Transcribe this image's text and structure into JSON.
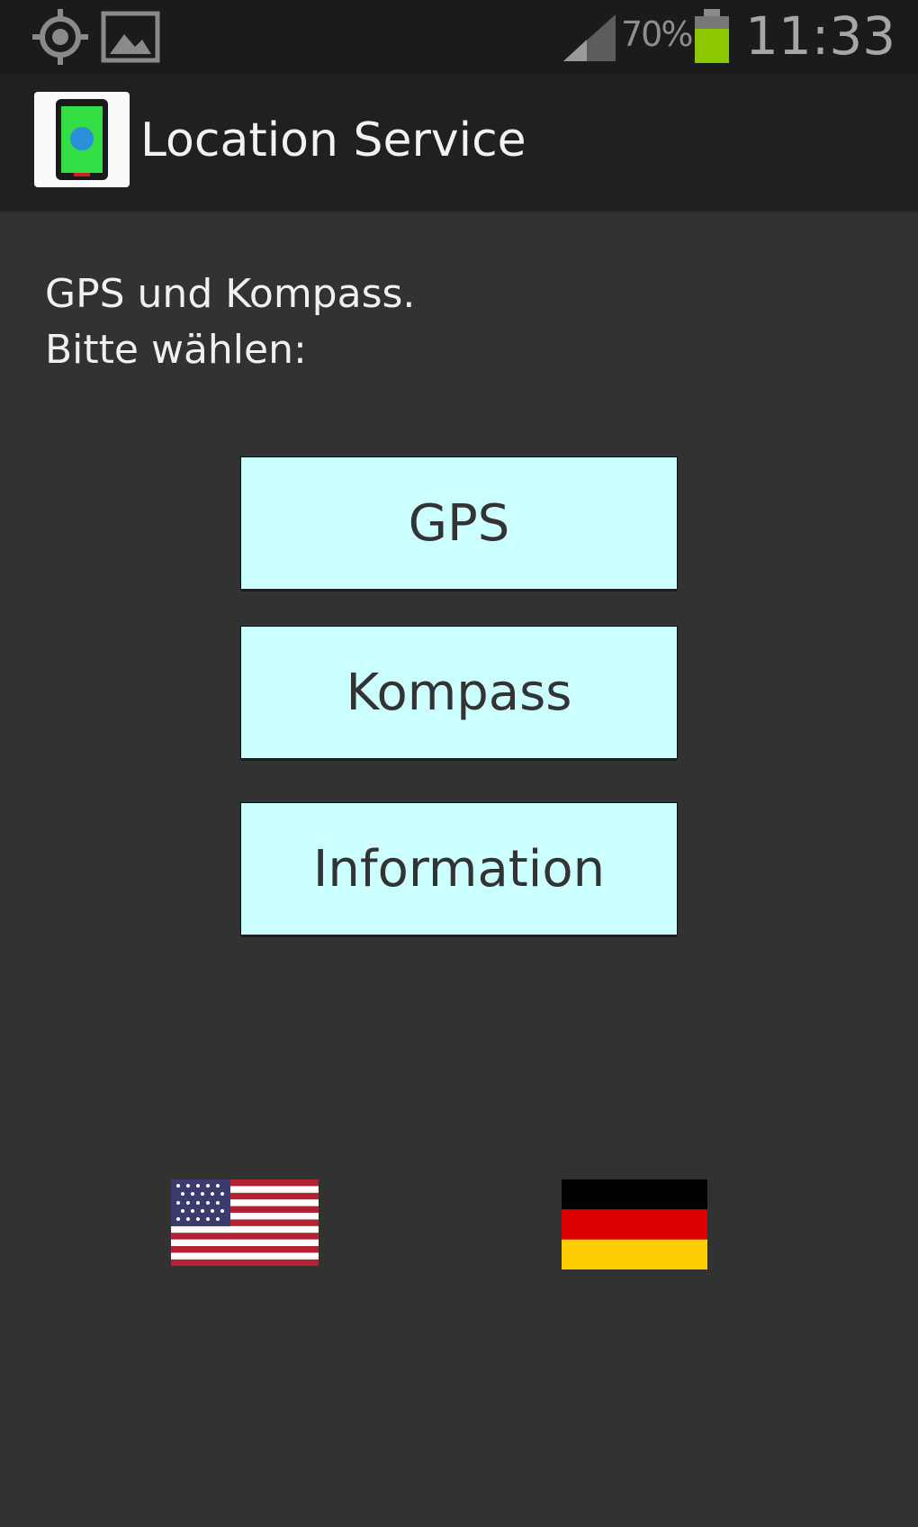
{
  "status_bar": {
    "battery_percent": "70%",
    "time": "11:33",
    "icons": [
      "gps-icon",
      "image-icon",
      "signal-icon",
      "battery-icon"
    ]
  },
  "action_bar": {
    "title": "Location Service",
    "icon": "app-icon"
  },
  "content": {
    "intro_line1": "GPS und Kompass.",
    "intro_line2": "Bitte wählen:",
    "buttons": [
      {
        "label": "GPS"
      },
      {
        "label": "Kompass"
      },
      {
        "label": "Information"
      }
    ],
    "language_flags": [
      "us-flag-icon",
      "germany-flag-icon"
    ]
  },
  "colors": {
    "background": "#323232",
    "button_background": "#ccffff",
    "button_text": "#333333",
    "title_text": "#f2f2f2",
    "battery_green": "#8cc800"
  }
}
